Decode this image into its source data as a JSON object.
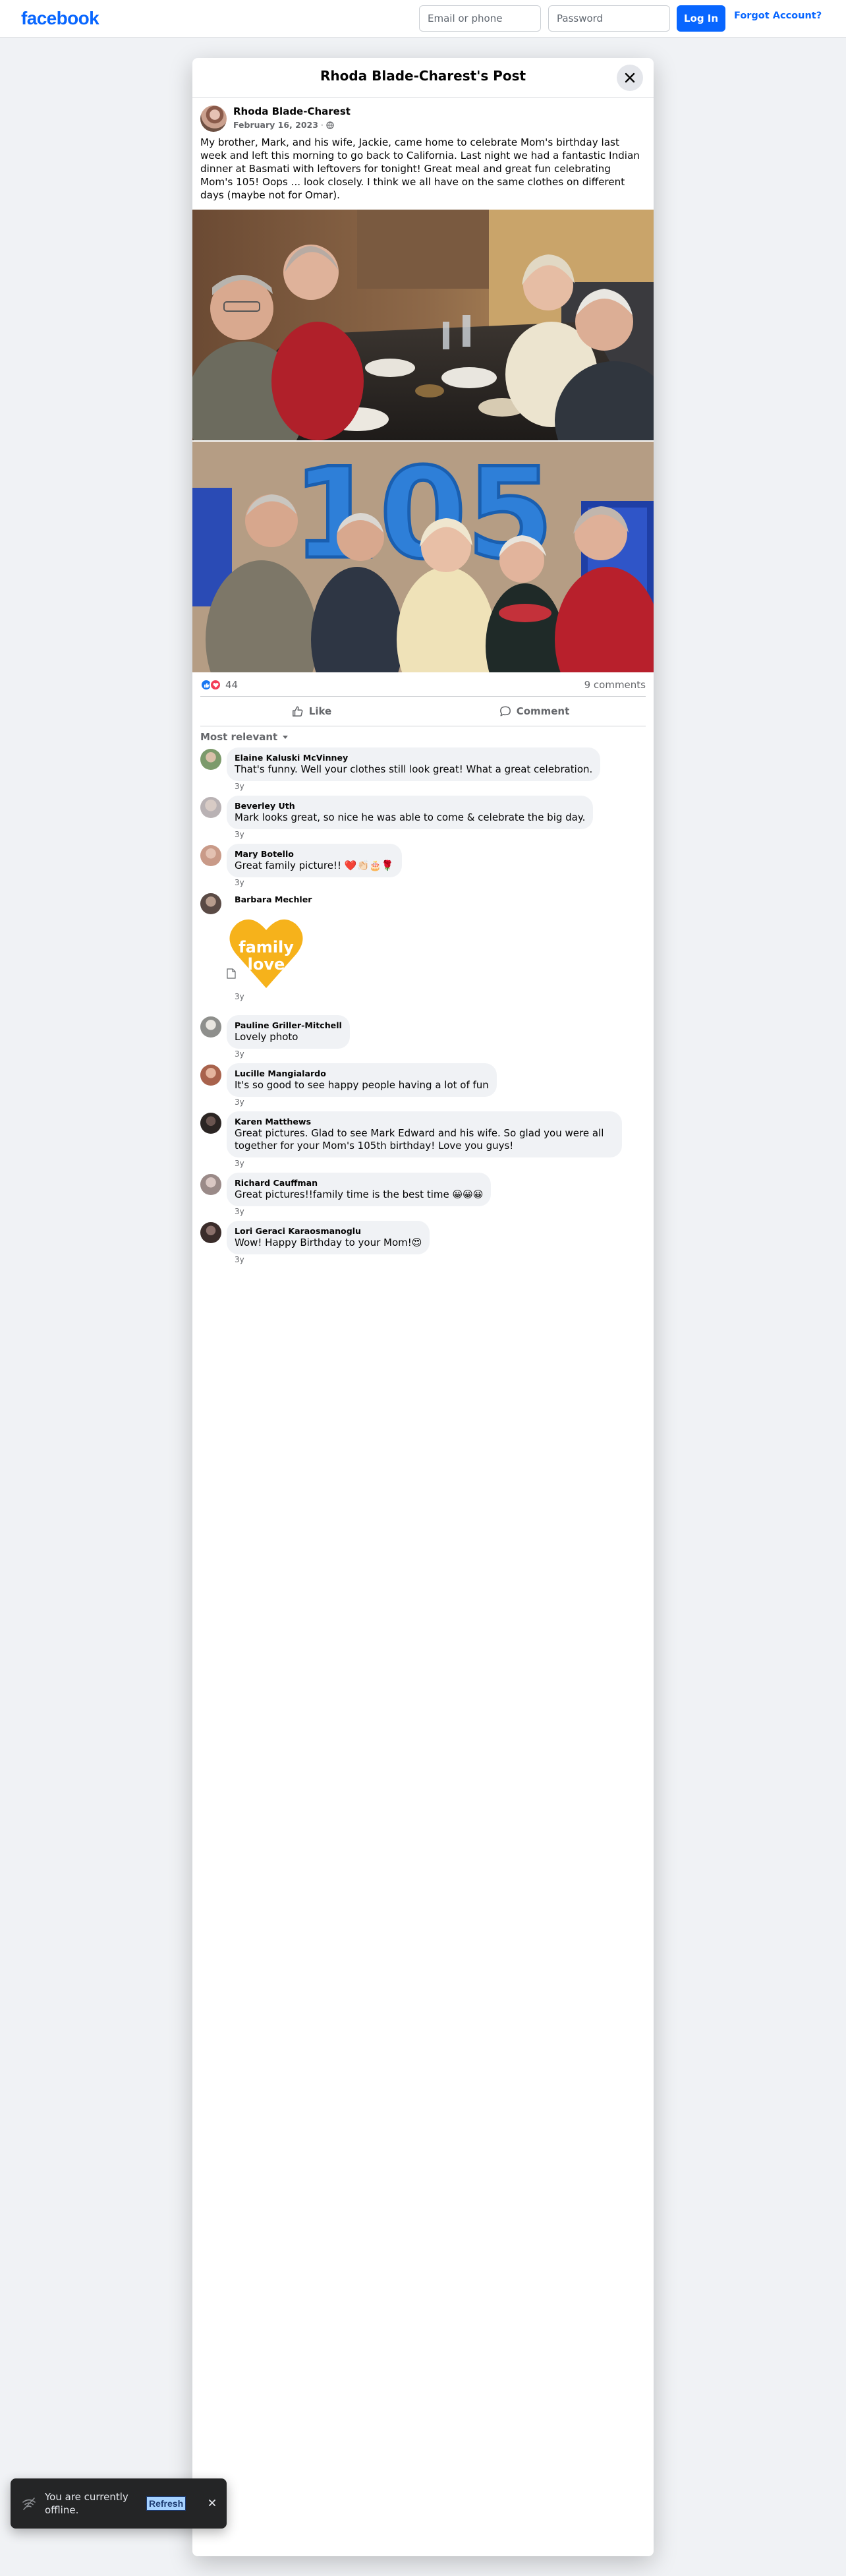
{
  "header": {
    "logo": "facebook",
    "email_placeholder": "Email or phone",
    "password_placeholder": "Password",
    "login_label": "Log In",
    "forgot_label": "Forgot Account?"
  },
  "post": {
    "title": "Rhoda Blade-Charest's Post",
    "author": "Rhoda Blade-Charest",
    "date": "February 16, 2023",
    "separator": "·",
    "text": "My brother, Mark, and his wife, Jackie, came home to celebrate Mom's birthday last week and left this morning to go back to California.  Last night we had a fantastic Indian dinner at Basmati with leftovers for tonight!  Great meal and great fun celebrating Mom's 105! Oops ... look closely.  I think we all have on the same clothes on different days (maybe not for Omar).",
    "balloon_text": "105",
    "reaction_count": "44",
    "comments_count": "9 comments",
    "like_label": "Like",
    "comment_label": "Comment",
    "sort_label": "Most relevant"
  },
  "comments": [
    {
      "name": "Elaine Kaluski McVinney",
      "text": "That's funny. Well your clothes still look great! What a great celebration.",
      "time": "3y",
      "avatar_color": "#7c9a6b"
    },
    {
      "name": "Beverley Uth",
      "text": "Mark looks great, so nice he was able to come & celebrate the big day.",
      "time": "3y",
      "avatar_color": "#b9b2b4"
    },
    {
      "name": "Mary Botello",
      "text": "Great family picture!! ❤️👏🏻🎂🌹",
      "time": "3y",
      "avatar_color": "#c99a88"
    },
    {
      "name": "Barbara Mechler",
      "sticker_line1": "family",
      "sticker_line2": "love",
      "time": "3y",
      "avatar_color": "#5a4a45"
    },
    {
      "name": "Pauline Griller-Mitchell",
      "text": "Lovely photo",
      "time": "3y",
      "avatar_color": "#8e8f8c"
    },
    {
      "name": "Lucille Mangialardo",
      "text": "It's so good to see happy people having a lot of fun",
      "time": "3y",
      "avatar_color": "#a8624c"
    },
    {
      "name": "Karen Matthews",
      "text": "Great pictures. Glad to see Mark Edward and his wife. So glad you were all together for your Mom's 105th birthday! Love you guys!",
      "time": "3y",
      "avatar_color": "#2b2523"
    },
    {
      "name": "Richard Cauffman",
      "text": "Great pictures!!family time is the best time 😀😀😀",
      "time": "3y",
      "avatar_color": "#9a8a88"
    },
    {
      "name": "Lori Geraci Karaosmanoglu",
      "text": "Wow! Happy Birthday to your Mom!😍",
      "time": "3y",
      "avatar_color": "#3a2c2a"
    }
  ],
  "toast": {
    "text": "You are currently offline.",
    "refresh_label": "Refresh"
  },
  "colors": {
    "brand": "#0866ff",
    "like_reaction": "#1877f2",
    "love_reaction": "#f33e58",
    "sticker": "#f6b21b"
  }
}
